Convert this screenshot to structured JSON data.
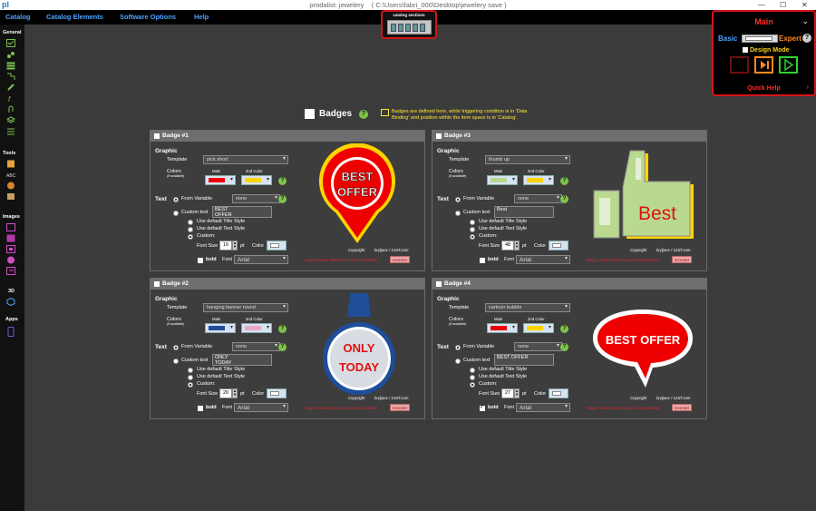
{
  "titlebar": {
    "logo": "pl",
    "app": "prodalist: jewelery",
    "path": "( C:\\Users\\fabri_000\\Desktop\\jewelery save )",
    "minimize": "—",
    "maximize": "☐",
    "close": "✕"
  },
  "menu": [
    "Catalog",
    "Catalog Elements",
    "Software Options",
    "Help"
  ],
  "sections_widget": {
    "label": "catalog sections"
  },
  "sidebar": {
    "general": "General",
    "tools": "Tools",
    "images": "Images",
    "threed": "3D",
    "apps": "Apps"
  },
  "main_panel": {
    "title": "Main",
    "basic": "Basic",
    "expert": "Expert",
    "design_mode": "Design Mode",
    "quick_help": "Quick Help",
    "help": "?"
  },
  "page": {
    "heading": "Badges",
    "note": "Badges are defined here, while triggering condition is in 'Data Binding' and position within the item space is in 'Catalog'."
  },
  "labels": {
    "graphic": "Graphic",
    "template": "Template",
    "colors": "Colors",
    "if_available": "(if available)",
    "main": "Main",
    "second": "2nd Color",
    "text": "Text",
    "from_variable": "From Variable",
    "custom_text": "Custom text",
    "default_title": "Use default Title Style",
    "default_text": "Use default Text Style",
    "custom": "Custom:",
    "font_size": "Font Size",
    "pt": "pt",
    "color": "Color",
    "bold": "bold",
    "font": "Font",
    "none": "none",
    "drag_hint": "drag w mouse wheel to get the text position",
    "recenter": "recenter",
    "copyright": "Copyright",
    "credit": "bryljaev / 123rf.com"
  },
  "badges": [
    {
      "title": "Badge #1",
      "template": "pick short",
      "custom_text": "BEST\nOFFER",
      "font_size": "10",
      "font": "Arial",
      "bold": false,
      "style": "custom",
      "main_color": "#ee0000",
      "second_color": "#ffd400",
      "preview": [
        "BEST",
        "OFFER"
      ]
    },
    {
      "title": "Badge #3",
      "template": "thumb up",
      "custom_text": "Best",
      "font_size": "48",
      "font": "Arial",
      "bold": false,
      "style": "custom",
      "main_color": "#b9d98f",
      "second_color": "#ffd400",
      "preview": [
        "Best"
      ]
    },
    {
      "title": "Badge #2",
      "template": "hanging banner round",
      "custom_text": "ONLY\nTODAY",
      "font_size": "20",
      "font": "Arial",
      "bold": false,
      "style": "custom",
      "main_color": "#1e4d9a",
      "second_color": "#e8a9c4",
      "preview": [
        "ONLY",
        "TODAY"
      ]
    },
    {
      "title": "Badge #4",
      "template": "cartoon bubble",
      "custom_text": "BEST OFFER",
      "font_size": "27",
      "font": "Arial",
      "bold": true,
      "style": "custom",
      "main_color": "#ee0000",
      "second_color": "#ffd400",
      "preview": [
        "BEST OFFER"
      ]
    }
  ],
  "colors": {
    "accent_red": "#d4141b",
    "menu_blue": "#4aa3ff",
    "help_green": "#7ec24a",
    "note_yellow": "#ffe633"
  }
}
